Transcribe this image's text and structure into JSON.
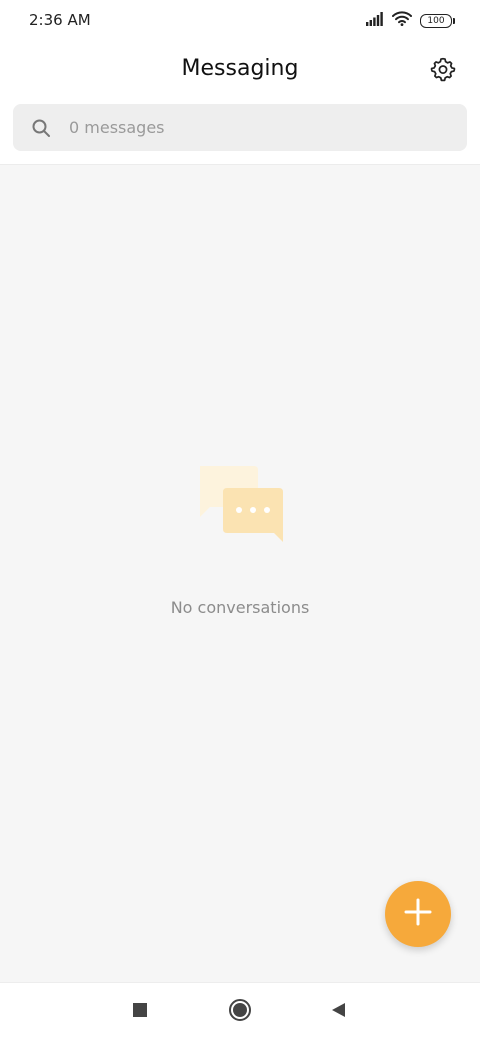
{
  "status_bar": {
    "time": "2:36 AM",
    "battery_level": "100",
    "icons": [
      "signal-icon",
      "wifi-icon",
      "battery-icon"
    ]
  },
  "header": {
    "title": "Messaging",
    "settings_icon": "gear-icon"
  },
  "search": {
    "placeholder": "0 messages",
    "icon": "search-icon"
  },
  "empty_state": {
    "text": "No conversations",
    "icon": "chat-bubbles-icon"
  },
  "fab": {
    "icon": "plus-icon",
    "color": "#f6a93b"
  },
  "nav_bar": {
    "buttons": [
      "recent-apps-icon",
      "home-icon",
      "back-icon"
    ]
  },
  "colors": {
    "accent": "#f6a93b",
    "content_background": "#f6f6f6",
    "search_background": "#eeeeee"
  }
}
